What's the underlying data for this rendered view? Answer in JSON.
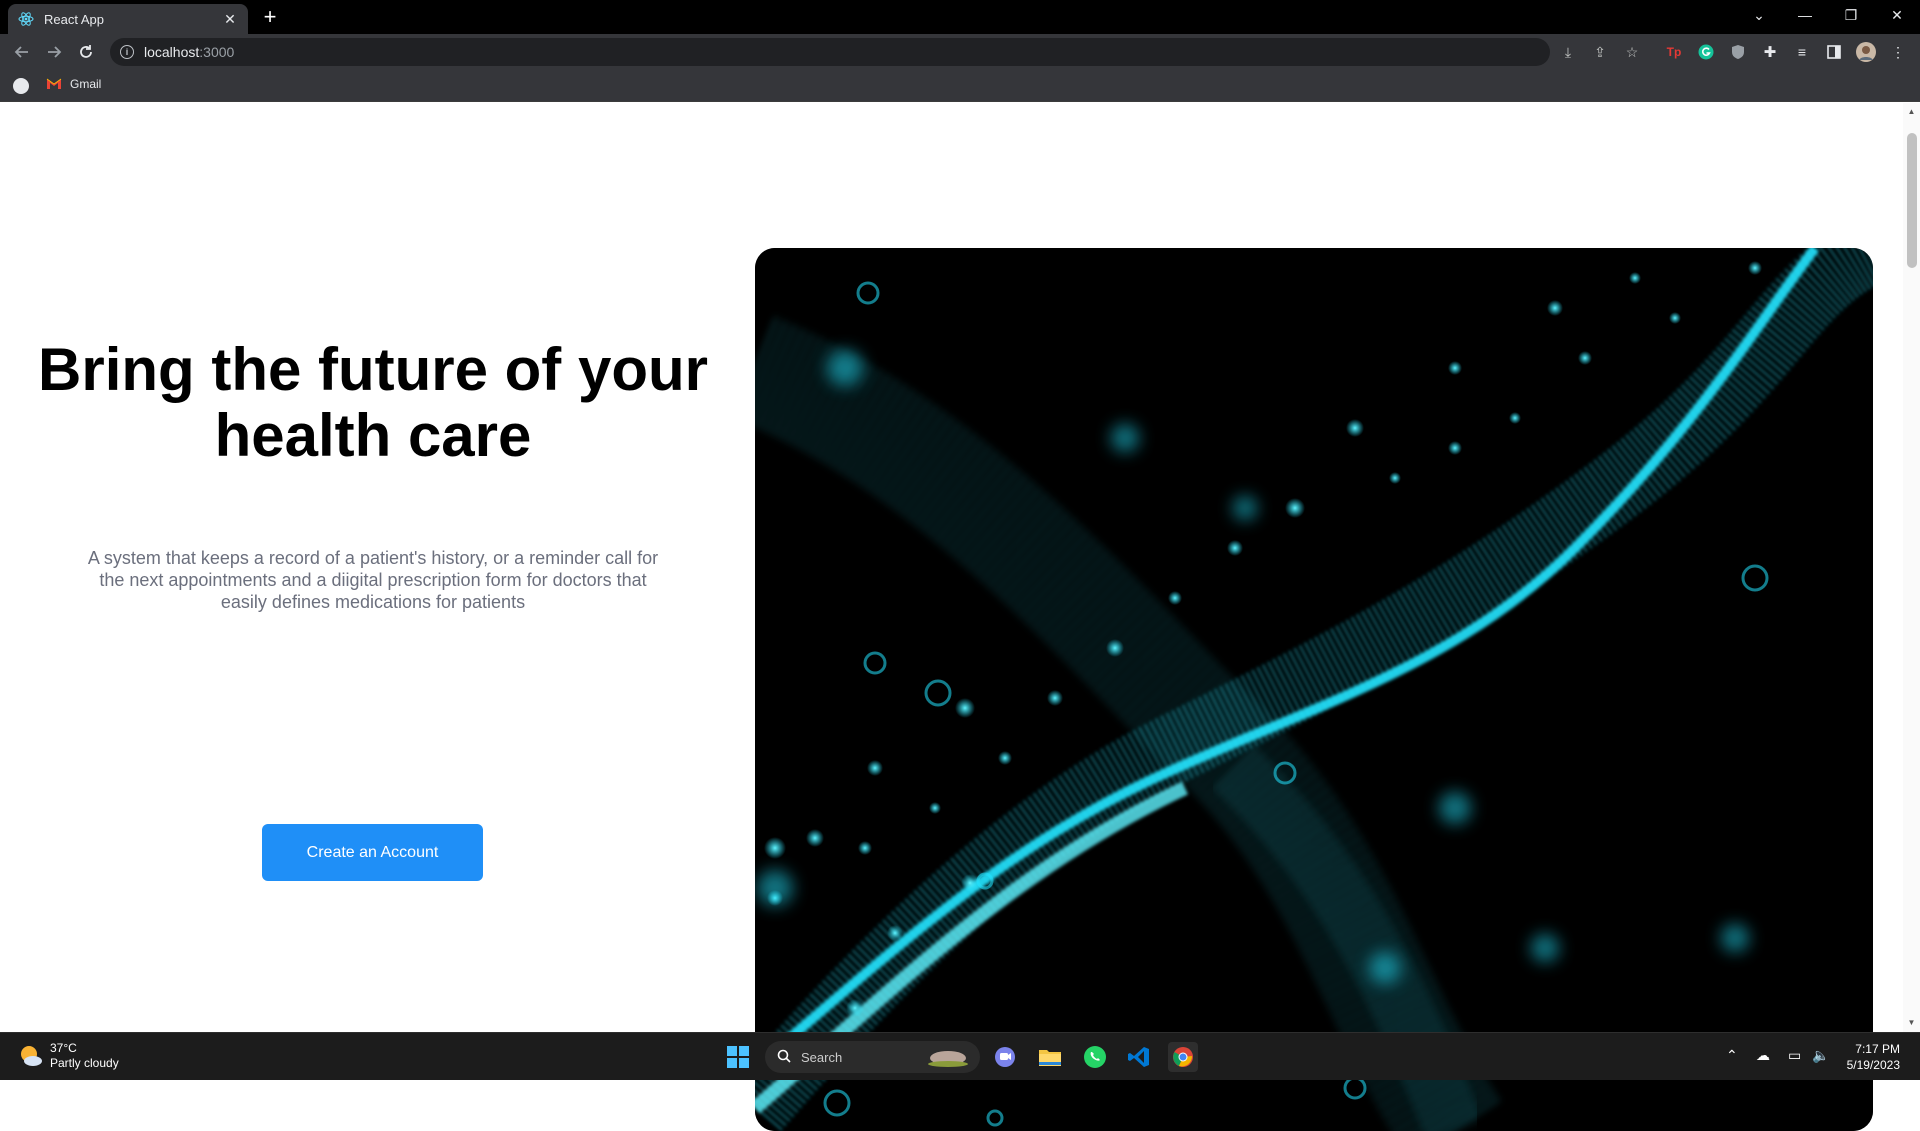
{
  "browser": {
    "tab_title": "React App",
    "tab_close": "✕",
    "new_tab": "+",
    "url_host": "localhost",
    "url_port": ":3000",
    "bookmark_gmail": "Gmail",
    "colors": {
      "tabbar": "#000000",
      "toolbar": "#35363a"
    }
  },
  "hero": {
    "title": "Bring the future of your health care",
    "description": "A system that keeps a record of a patient's history, or a reminder call for the next appointments and a diigital prescription form for doctors that easily defines medications for patients",
    "cta_label": "Create an Account",
    "image_alt": "DNA helix illustration",
    "colors": {
      "cta": "#1f8ff7",
      "description": "#6b6f7d",
      "helix": "#22e4ff"
    }
  },
  "taskbar": {
    "weather_temp": "37°C",
    "weather_condition": "Partly cloudy",
    "search_label": "Search",
    "time": "7:17 PM",
    "date": "5/19/2023"
  }
}
